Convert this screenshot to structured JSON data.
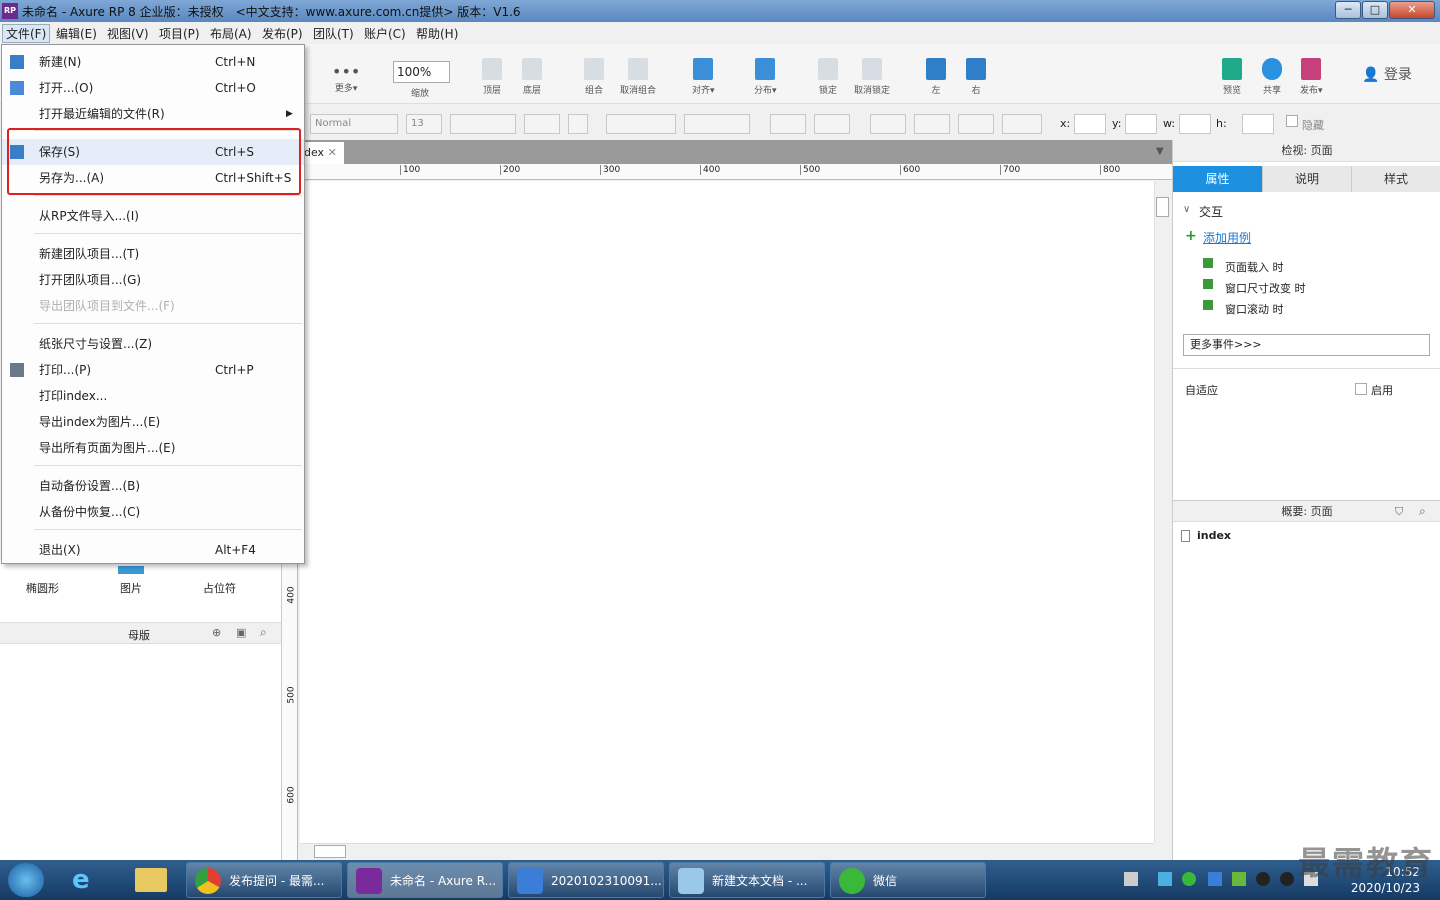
{
  "window": {
    "title": "未命名 - Axure RP 8 企业版：未授权　<中文支持：www.axure.com.cn提供> 版本：V1.6",
    "app_icon": "RP",
    "controls": [
      "─",
      "□",
      "✕"
    ]
  },
  "menubar": [
    "文件(F)",
    "编辑(E)",
    "视图(V)",
    "项目(P)",
    "布局(A)",
    "发布(P)",
    "团队(T)",
    "账户(C)",
    "帮助(H)"
  ],
  "toolbar": {
    "zoom_value": "100%",
    "zoom_label": "缩放",
    "more_label": "更多▾",
    "items": [
      "顶层",
      "底层",
      "组合",
      "取消组合",
      "对齐▾",
      "分布▾",
      "锁定",
      "取消锁定",
      "左",
      "右"
    ],
    "right_items": [
      "预览",
      "共享",
      "发布▾"
    ],
    "login": "登录"
  },
  "formatbar": {
    "font_style": "Normal",
    "font_size": "13",
    "x_label": "x:",
    "y_label": "y:",
    "w_label": "w:",
    "h_label": "h:",
    "hidden_label": "隐藏"
  },
  "file_menu": {
    "items": [
      {
        "label": "新建(N)",
        "shortcut": "Ctrl+N",
        "icon": "new-file-icon"
      },
      {
        "label": "打开...(O)",
        "shortcut": "Ctrl+O",
        "icon": "open-folder-icon"
      },
      {
        "label": "打开最近编辑的文件(R)",
        "shortcut": "",
        "submenu": true
      },
      {
        "label": "保存(S)",
        "shortcut": "Ctrl+S",
        "icon": "save-icon"
      },
      {
        "label": "另存为...(A)",
        "shortcut": "Ctrl+Shift+S"
      },
      {
        "label": "从RP文件导入...(I)",
        "shortcut": ""
      },
      {
        "label": "新建团队项目...(T)",
        "shortcut": ""
      },
      {
        "label": "打开团队项目...(G)",
        "shortcut": ""
      },
      {
        "label": "导出团队项目到文件...(F)",
        "shortcut": "",
        "disabled": true
      },
      {
        "label": "纸张尺寸与设置...(Z)",
        "shortcut": ""
      },
      {
        "label": "打印...(P)",
        "shortcut": "Ctrl+P",
        "icon": "print-icon"
      },
      {
        "label": "打印index...",
        "shortcut": ""
      },
      {
        "label": "导出index为图片...(E)",
        "shortcut": ""
      },
      {
        "label": "导出所有页面为图片...(E)",
        "shortcut": ""
      },
      {
        "label": "自动备份设置...(B)",
        "shortcut": ""
      },
      {
        "label": "从备份中恢复...(C)",
        "shortcut": ""
      },
      {
        "label": "退出(X)",
        "shortcut": "Alt+F4"
      }
    ]
  },
  "left_panel": {
    "widgets": [
      "椭圆形",
      "图片",
      "占位符"
    ],
    "masters_title": "母版"
  },
  "canvas": {
    "tab_label": "dex",
    "ruler_top": [
      "100",
      "200",
      "300",
      "400",
      "500",
      "600",
      "700",
      "800"
    ],
    "ruler_left": [
      "400",
      "500",
      "600"
    ]
  },
  "inspector": {
    "title": "检视: 页面",
    "tabs": [
      "属性",
      "说明",
      "样式"
    ],
    "section_interaction": "交互",
    "add_case": "添加用例",
    "events": [
      "页面载入 时",
      "窗口尺寸改变 时",
      "窗口滚动 时"
    ],
    "more_events": "更多事件>>>",
    "adaptive_label": "自适应",
    "enable_label": "启用"
  },
  "outline": {
    "title": "概要: 页面",
    "page": "index"
  },
  "taskbar": {
    "items": [
      "发布提问 - 最需...",
      "未命名 - Axure R...",
      "2020102310091...",
      "新建文本文档 - ...",
      "微信"
    ],
    "time": "10:52",
    "date": "2020/10/23"
  },
  "watermark": "最需教育",
  "colors": {
    "accent": "#1e90e0",
    "highlight_box": "#e02020"
  }
}
